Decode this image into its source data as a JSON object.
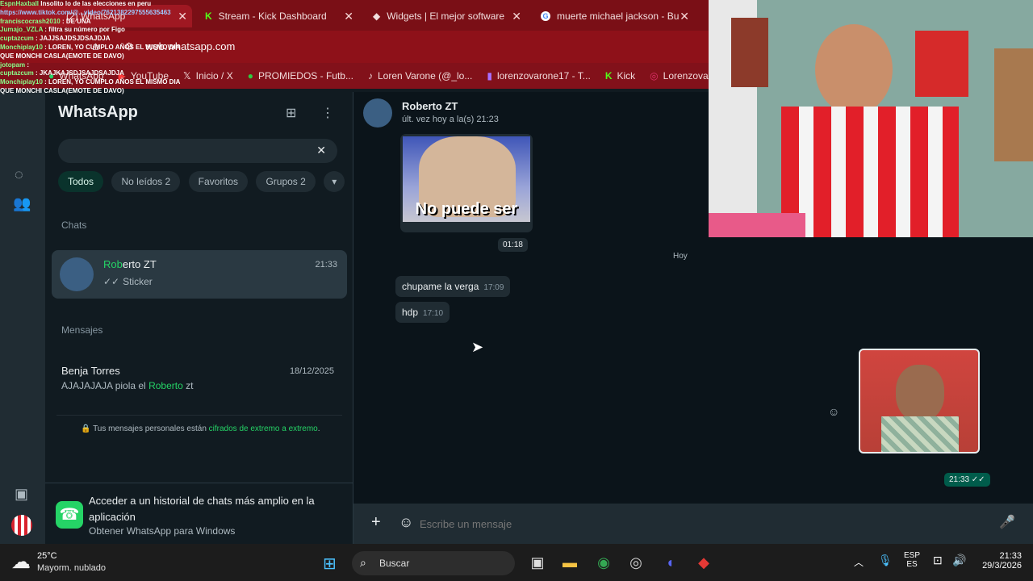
{
  "browser": {
    "tabs": [
      {
        "label": "(2) WhatsApp",
        "active": true
      },
      {
        "label": "Stream - Kick Dashboard"
      },
      {
        "label": "Widgets | El mejor software"
      },
      {
        "label": "muerte michael jackson - Bu"
      }
    ],
    "url": "web.whatsapp.com"
  },
  "bookmarks": [
    "WhatsApp",
    "YouTube",
    "Inicio / X",
    "PROMIEDOS - Futb...",
    "Loren Varone (@_lo...",
    "lorenzovarone17 - T...",
    "Kick",
    "Lorenzovarone (Inst..."
  ],
  "overlay_chat": [
    {
      "user": "EspnHaxball",
      "text": "Insolito lo de las elecciones en peru"
    },
    {
      "user": "",
      "text": "https://www.tiktok.com/@...video/7621382297555635463"
    },
    {
      "user": "franciscocrash2010",
      "text": ": DE UNA"
    },
    {
      "user": "Jumajo_VZLA",
      "text": ": filtra su número por Figo"
    },
    {
      "user": "cuptazcum",
      "text": ": JAJJSAJDSJDSAJDJA"
    },
    {
      "user": "Monchiplay10",
      "text": ": LOREN, YO CUMPLO AÑOS EL MISMO DIA QUE MONCHI CASLA(EMOTE DE DAVO)"
    },
    {
      "user": "jotopam",
      "text": ":"
    },
    {
      "user": "cuptazcum",
      "text": ": JKAJKAJSDJSAJDSAJDJA"
    },
    {
      "user": "Monchiplay10",
      "text": ": LOREN, YO CUMPLO AÑOS EL MISMO DIA QUE MONCHI CASLA(EMOTE DE DAVO)"
    }
  ],
  "whatsapp": {
    "app_title": "WhatsApp",
    "filters": [
      "Todos",
      "No leídos 2",
      "Favoritos",
      "Grupos 2"
    ],
    "chats_heading": "Chats",
    "chat_item": {
      "name_highlight": "Rob",
      "name_rest": "erto ZT",
      "time": "21:33",
      "preview": "Sticker"
    },
    "messages_heading": "Mensajes",
    "message_item": {
      "name": "Benja Torres",
      "date": "18/12/2025",
      "text_before": "AJAJAJAJA piola el ",
      "text_highlight": "Roberto",
      "text_after": " zt"
    },
    "encryption_note": {
      "before": "Tus mensajes personales están ",
      "highlight": "cifrados de extremo a extremo",
      "after": "."
    },
    "promo": {
      "title": "Acceder a un historial de chats más amplio en la aplicación",
      "subtitle": "Obtener WhatsApp para Windows"
    },
    "conversation": {
      "name": "Roberto ZT",
      "status": "últ. vez hoy a la(s) 21:23",
      "image_caption": "No puede ser",
      "image_time": "01:18",
      "day_label": "Hoy",
      "messages": [
        {
          "text": "chupame la verga",
          "time": "17:09"
        },
        {
          "text": "hdp",
          "time": "17:10"
        }
      ],
      "sticker_time": "21:33 ✓✓"
    },
    "composer": {
      "placeholder": "Escribe un mensaje"
    }
  },
  "taskbar": {
    "weather": {
      "temp": "25°C",
      "desc": "Mayorm. nublado"
    },
    "search": "Buscar",
    "lang": "ESP",
    "lang2": "ES",
    "time": "21:33",
    "date": "29/3/2026"
  },
  "colors": {
    "accent": "#25d366",
    "browser": "#8e1119",
    "panel": "#111b21",
    "chat_bg": "#0b141a"
  }
}
